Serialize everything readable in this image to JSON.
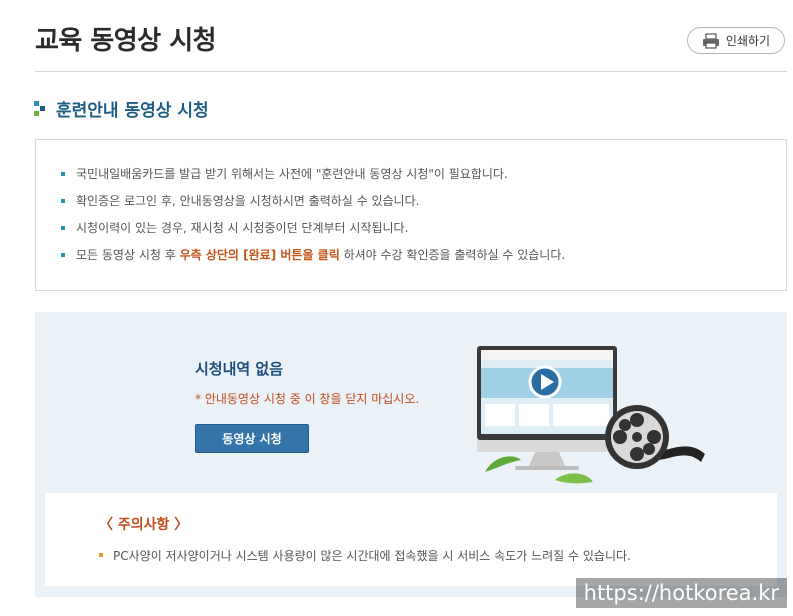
{
  "header": {
    "title": "교육 동영상 시청",
    "print_label": "인쇄하기"
  },
  "section": {
    "title": "훈련안내 동영상 시청"
  },
  "notices": {
    "item1": "국민내일배움카드를 발급 받기 위해서는 사전에 \"훈련안내 동영상 시청\"이 필요합니다.",
    "item2": "확인증은 로그인 후, 안내동영상을 시청하시면 출력하실 수 있습니다.",
    "item3": "시청이력이 있는 경우, 재시청 시 시청중이던 단계부터 시작됩니다.",
    "item4_before": "모든 동영상 시청 후 ",
    "item4_highlight": "우측 상단의 [완료] 버튼을 클릭",
    "item4_after": " 하셔야 수강 확인증을 출력하실 수 있습니다."
  },
  "status": {
    "title": "시청내역 없음",
    "warning": "* 안내동영상 시청 중 이 창을 닫지 마십시오.",
    "button_label": "동영상 시청"
  },
  "caution": {
    "title": "〈 주의사항 〉",
    "text": "PC사양이 저사양이거나 시스템 사용량이 많은 시간대에 접속했을 시 서비스 속도가 느려질 수 있습니다."
  },
  "watermark": "https://hotkorea.kr",
  "icons": {
    "print": "printer-icon",
    "section": "bullet-squares-icon",
    "illustration": "monitor-film-reel-illustration"
  },
  "colors": {
    "title_blue": "#1f5d87",
    "highlight_orange": "#c4561b",
    "button_blue": "#3474a8",
    "panel_bg": "#eaf2f8"
  }
}
